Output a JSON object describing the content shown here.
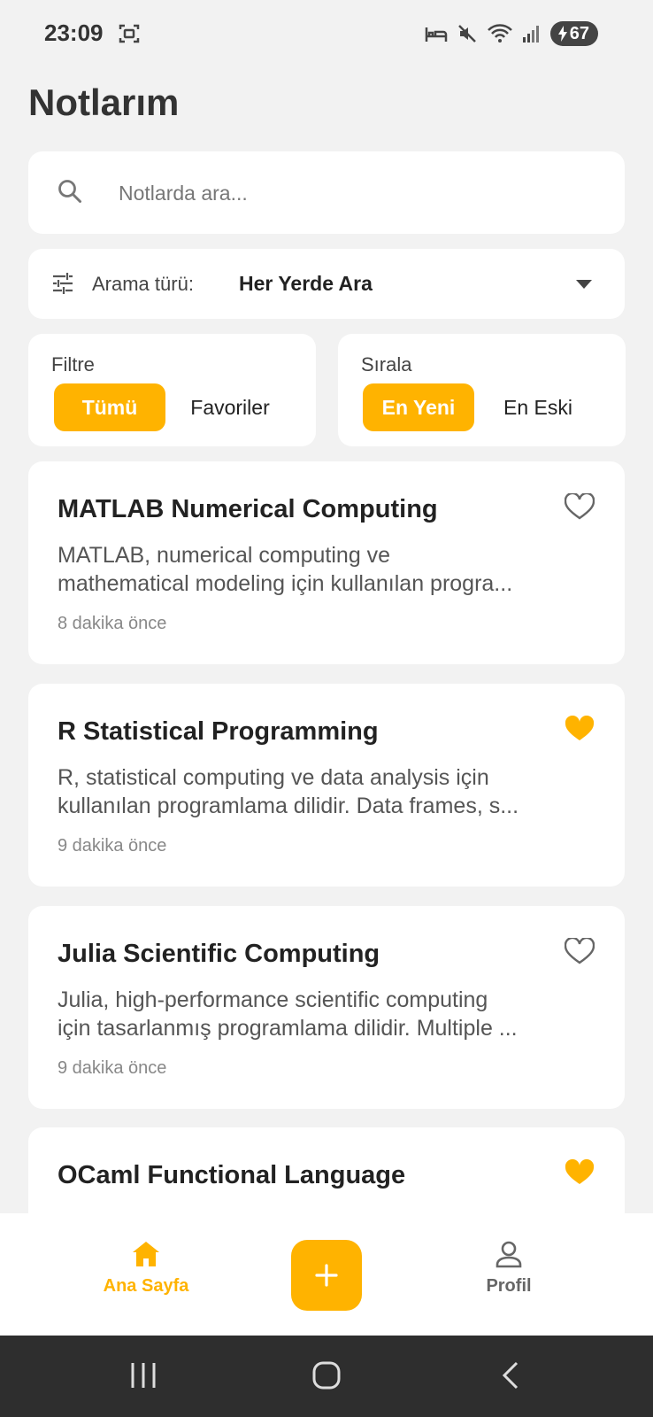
{
  "status_bar": {
    "time": "23:09",
    "battery": "67"
  },
  "page": {
    "title": "Notlarım"
  },
  "search": {
    "placeholder": "Notlarda ara..."
  },
  "search_type": {
    "label": "Arama türü:",
    "value": "Her Yerde Ara"
  },
  "filter": {
    "caption": "Filtre",
    "options": [
      "Tümü",
      "Favoriler"
    ],
    "selected": "Tümü"
  },
  "sort": {
    "caption": "Sırala",
    "options": [
      "En Yeni",
      "En Eski"
    ],
    "selected": "En Yeni"
  },
  "notes": [
    {
      "title": "MATLAB Numerical Computing",
      "body": "MATLAB, numerical computing ve\nmathematical modeling için kullanılan progra...",
      "time": "8 dakika önce",
      "favorite": false
    },
    {
      "title": "R Statistical Programming",
      "body": "R, statistical computing ve data analysis için\nkullanılan programlama dilidir. Data frames, s...",
      "time": "9 dakika önce",
      "favorite": true
    },
    {
      "title": "Julia Scientific Computing",
      "body": "Julia, high-performance scientific computing\niçin tasarlanmış programlama dilidir. Multiple ...",
      "time": "9 dakika önce",
      "favorite": false
    },
    {
      "title": "OCaml Functional Language",
      "body": "",
      "time": "",
      "favorite": true
    }
  ],
  "bottom_nav": {
    "home": "Ana Sayfa",
    "profile": "Profil"
  },
  "colors": {
    "accent": "#ffb300",
    "background": "#f2f2f2",
    "card": "#ffffff"
  }
}
